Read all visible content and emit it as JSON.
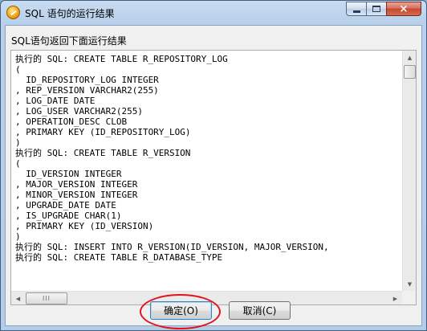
{
  "window": {
    "title": "SQL 语句的运行结果",
    "icon": "app-icon",
    "caption_buttons": {
      "minimize": "minimize-icon",
      "maximize": "maximize-icon",
      "close": "×"
    }
  },
  "dialog": {
    "label": "SQL语句返回下面运行结果",
    "sql_output": "执行的 SQL: CREATE TABLE R_REPOSITORY_LOG\n(\n  ID_REPOSITORY_LOG INTEGER\n, REP_VERSION VARCHAR2(255)\n, LOG_DATE DATE\n, LOG_USER VARCHAR2(255)\n, OPERATION_DESC CLOB\n, PRIMARY KEY (ID_REPOSITORY_LOG)\n)\n执行的 SQL: CREATE TABLE R_VERSION\n(\n  ID_VERSION INTEGER\n, MAJOR_VERSION INTEGER\n, MINOR_VERSION INTEGER\n, UPGRADE_DATE DATE\n, IS_UPGRADE CHAR(1)\n, PRIMARY KEY (ID_VERSION)\n)\n执行的 SQL: INSERT INTO R_VERSION(ID_VERSION, MAJOR_VERSION,\n执行的 SQL: CREATE TABLE R_DATABASE_TYPE",
    "scroll_grip": "III"
  },
  "buttons": {
    "ok_label": "确定(O)",
    "cancel_label": "取消(C)"
  },
  "colors": {
    "highlight": "#e0141c",
    "titlebar": "#c9dcf0",
    "close_button": "#c14a32"
  }
}
